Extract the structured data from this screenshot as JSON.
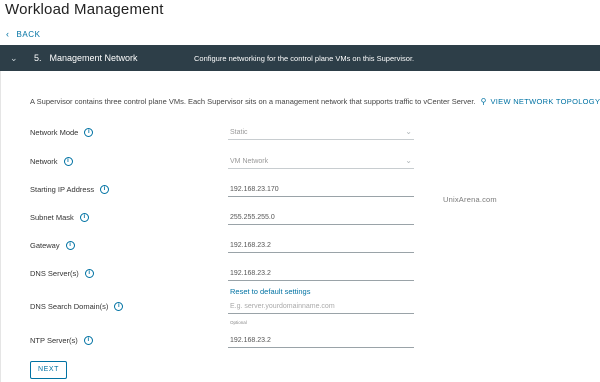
{
  "app": {
    "title": "Workload Management"
  },
  "nav": {
    "back_label": "BACK",
    "back_icon": "chevron-left-icon"
  },
  "step": {
    "number": "5.",
    "name": "Management Network",
    "description": "Configure networking for the control plane VMs on this Supervisor."
  },
  "intro": {
    "text": "A Supervisor contains three control plane VMs. Each Supervisor sits on a management network that supports traffic to vCenter Server.",
    "link_label": "VIEW NETWORK TOPOLOGY"
  },
  "form": {
    "network_mode": {
      "label": "Network Mode",
      "value": "Static"
    },
    "network": {
      "label": "Network",
      "value": "VM Network"
    },
    "starting_ip": {
      "label": "Starting IP Address",
      "value": "192.168.23.170"
    },
    "subnet_mask": {
      "label": "Subnet Mask",
      "value": "255.255.255.0"
    },
    "gateway": {
      "label": "Gateway",
      "value": "192.168.23.2"
    },
    "dns_servers": {
      "label": "DNS Server(s)",
      "value": "192.168.23.2",
      "reset_label": "Reset to default settings"
    },
    "dns_search": {
      "label": "DNS Search Domain(s)",
      "placeholder": "E.g. server.yourdomainname.com",
      "hint": "Optional"
    },
    "ntp_servers": {
      "label": "NTP Server(s)",
      "value": "192.168.23.2"
    }
  },
  "watermark": "UnixArena.com",
  "actions": {
    "next_label": "NEXT"
  },
  "colors": {
    "header_bg": "#2d3e48",
    "link": "#0072a3"
  }
}
